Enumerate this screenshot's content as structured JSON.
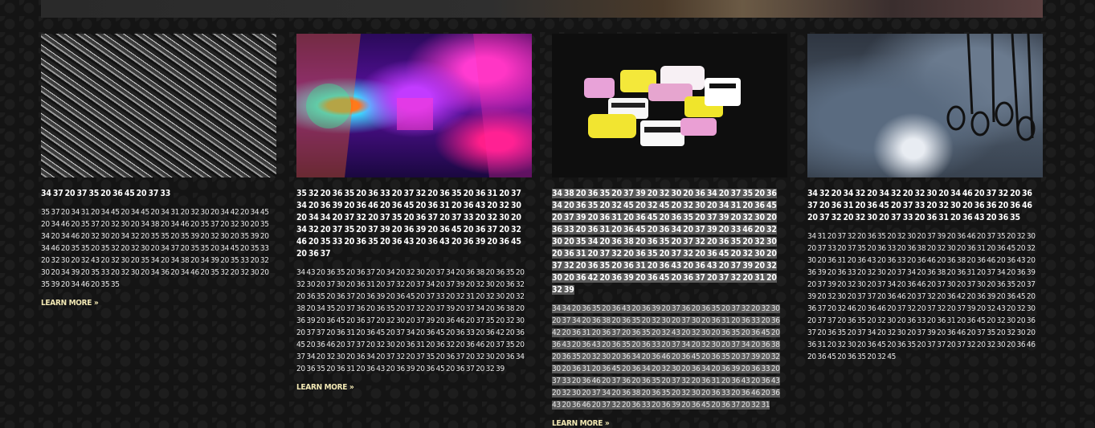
{
  "cards": [
    {
      "title": "34 37 20 37 35 20 36 45 20 37 33",
      "body": "35 37 20 34 31 20 34 45 20 34 45 20 34 31 20 32 30 20 34 42 20 34 45 20 34 46 20 35 37 20 32 30 20 34 38 20 34 46 20 35 37 20 32 30 20 35 34 20 34 46 20 32 30 20 34 32 20 35 35 20 35 39 20 32 30 20 35 39 20 34 46 20 35 35 20 35 32 20 32 30 20 34 37 20 35 35 20 34 45 20 35 33 20 32 30 20 32 43 20 32 30 20 35 34 20 34 38 20 34 39 20 35 33 20 32 30 20 34 39 20 35 33 20 32 30 20 34 36 20 34 46 20 35 32 20 32 30 20 35 39 20 34 46 20 35 35",
      "more": "LEARN MORE »"
    },
    {
      "title": "35 32 20 36 35 20 36 33 20 37 32 20 36 35 20 36 31 20 37 34 20 36 39 20 36 46 20 36 45 20 36 31 20 36 43 20 32 30 20 34 34 20 37 32 20 37 35 20 36 37 20 37 33 20 32 30 20 34 32 20 37 35 20 37 39 20 36 39 20 36 45 20 36 37 20 32 46 20 35 33 20 36 35 20 36 43 20 36 43 20 36 39 20 36 45 20 36 37",
      "body": "34 43 20 36 35 20 36 37 20 34 20 32 30 20 37 34 20 36 38 20 36 35 20 32 30 20 37 30 20 36 31 20 37 32 20 37 34 20 37 39 20 32 30 20 36 32 20 36 35 20 36 37 20 36 39 20 36 45 20 37 33 20 32 31 20 32 30 20 32 38 20 34 35 20 37 36 20 36 35 20 37 32 20 37 39 20 37 34 20 36 38 20 36 39 20 36 45 20 36 37 20 32 30 20 37 39 20 36 46 20 37 35 20 32 30 20 37 37 20 36 31 20 36 45 20 37 34 20 36 45 20 36 33 20 36 42 20 36 45 20 36 46 20 37 37 20 32 30 20 36 31 20 36 32 20 36 46 20 37 35 20 37 34 20 32 30 20 36 34 20 37 32 20 37 35 20 36 37 20 32 30 20 36 34 20 36 35 20 36 31 20 36 43 20 36 39 20 36 45 20 36 37 20 32 39",
      "more": "LEARN MORE »"
    },
    {
      "title": "34 38 20 36 35 20 37 39 20 32 30 20 36 34 20 37 35 20 36 34 20 36 35 20 32 45 20 32 45 20 32 30 20 34 31 20 36 45 20 37 39 20 36 31 20 36 45 20 36 35 20 37 39 20 32 30 20 36 33 20 36 31 20 36 45 20 36 34 20 37 39 20 33 46 20 32 30 20 35 34 20 36 38 20 36 35 20 37 32 20 36 35 20 32 30 20 36 31 20 37 32 20 36 35 20 37 32 20 36 45 20 32 30 20 37 32 20 36 35 20 36 31 20 36 43 20 36 43 20 37 39 20 32 30 20 36 42 20 36 39 20 36 45 20 36 37 20 37 32 20 31 20 32 39",
      "body": "34 34 20 36 35 20 36 43 20 36 39 20 37 36 20 36 35 20 37 32 20 32 30 20 37 34 20 36 38 20 36 35 20 32 30 20 37 30 20 36 31 20 36 33 20 36 42 20 36 31 20 36 37 20 36 35 20 32 43 20 32 30 20 36 35 20 36 45 20 36 43 20 36 43 20 36 35 20 36 33 20 37 34 20 32 30 20 37 34 20 36 38 20 36 35 20 32 30 20 36 34 20 36 46 20 36 45 20 36 35 20 37 39 20 32 30 20 36 31 20 36 45 20 36 34 20 32 30 20 36 34 20 36 39 20 36 33 20 37 33 20 36 46 20 37 36 20 36 35 20 37 32 20 36 31 20 36 43 20 36 43 20 32 30 20 37 34 20 36 38 20 36 35 20 32 30 20 36 33 20 36 46 20 36 43 20 36 46 20 37 32 20 36 33 20 36 39 20 36 45 20 36 37 20 32 31",
      "more": "LEARN MORE »"
    },
    {
      "title": "34 32 20 34 32 20 34 32 20 32 30 20 34 46 20 37 32 20 36 37 20 36 31 20 36 45 20 37 33 20 32 30 20 36 36 20 36 46 20 37 32 20 32 30 20 37 33 20 36 31 20 36 43 20 36 35",
      "body": "34 31 20 37 32 20 36 35 20 32 30 20 37 39 20 36 46 20 37 35 20 32 30 20 37 33 20 37 35 20 36 33 20 36 38 20 32 30 20 36 31 20 36 45 20 32 30 20 36 31 20 36 43 20 36 33 20 36 46 20 36 38 20 36 46 20 36 43 20 36 39 20 36 33 20 32 30 20 37 34 20 36 38 20 36 31 20 37 34 20 36 39 20 37 39 20 32 30 20 37 34 20 36 46 20 37 30 20 37 30 20 36 35 20 37 39 20 32 30 20 37 37 20 36 46 20 37 32 20 36 42 20 36 39 20 36 45 20 36 37 20 32 46 20 36 46 20 37 32 20 37 32 20 37 39 20 32 43 20 32 30 20 37 37 20 36 35 20 32 30 20 36 33 20 36 31 20 36 45 20 32 30 20 36 37 20 36 35 20 37 34 20 32 30 20 37 39 20 36 46 20 37 35 20 32 30 20 36 31 20 32 30 20 36 45 20 36 35 20 37 37 20 37 32 20 32 30 20 36 46 20 36 45 20 36 35 20 32 45",
      "more": ""
    }
  ]
}
